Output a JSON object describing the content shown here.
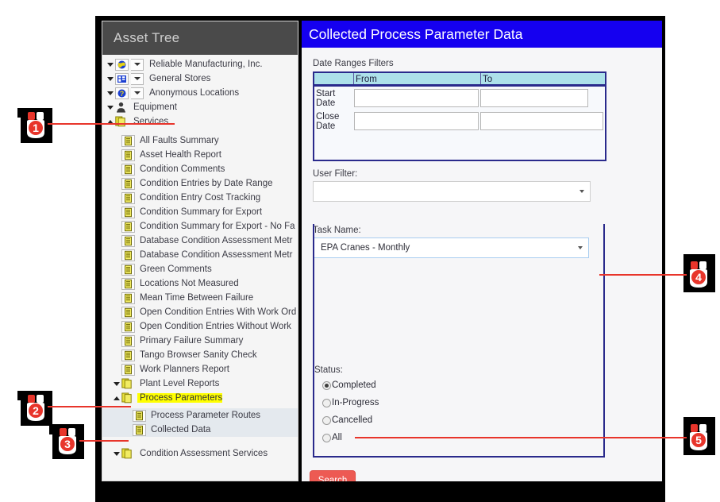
{
  "window": {
    "tree_panel_title": "Asset Tree",
    "content_title": "Collected Process Parameter Data"
  },
  "tree": {
    "items": [
      {
        "label": "Reliable Manufacturing, Inc.",
        "icon": "globe-icon",
        "level": 0,
        "caret": "down",
        "has_dropdown": true
      },
      {
        "label": "General Stores",
        "icon": "building-icon",
        "level": 0,
        "caret": "down",
        "has_dropdown": true
      },
      {
        "label": "Anonymous Locations",
        "icon": "question-globe-icon",
        "level": 0,
        "caret": "down",
        "has_dropdown": true
      },
      {
        "label": "Equipment",
        "icon": "person-icon",
        "level": 0,
        "caret": "down",
        "has_dropdown": false
      },
      {
        "label": "Services",
        "icon": "folders-icon",
        "level": 0,
        "caret": "up",
        "has_dropdown": false
      },
      {
        "label": "All Faults Summary",
        "icon": "report-icon",
        "level": 1
      },
      {
        "label": "Asset Health Report",
        "icon": "report-icon",
        "level": 1
      },
      {
        "label": "Condition Comments",
        "icon": "report-icon",
        "level": 1
      },
      {
        "label": "Condition Entries by Date Range",
        "icon": "report-icon",
        "level": 1
      },
      {
        "label": "Condition Entry Cost Tracking",
        "icon": "report-icon",
        "level": 1
      },
      {
        "label": "Condition Summary for Export",
        "icon": "report-icon",
        "level": 1
      },
      {
        "label": "Condition Summary for Export - No Fa",
        "icon": "report-icon",
        "level": 1
      },
      {
        "label": "Database Condition Assessment Metr",
        "icon": "report-icon",
        "level": 1
      },
      {
        "label": "Database Condition Assessment Metr",
        "icon": "report-icon",
        "level": 1
      },
      {
        "label": "Green Comments",
        "icon": "report-icon",
        "level": 1
      },
      {
        "label": "Locations Not Measured",
        "icon": "report-icon",
        "level": 1
      },
      {
        "label": "Mean Time Between Failure",
        "icon": "report-icon",
        "level": 1
      },
      {
        "label": "Open Condition Entries With Work Ord",
        "icon": "report-icon",
        "level": 1
      },
      {
        "label": "Open Condition Entries Without Work",
        "icon": "report-icon",
        "level": 1
      },
      {
        "label": "Primary Failure Summary",
        "icon": "report-icon",
        "level": 1
      },
      {
        "label": "Tango Browser Sanity Check",
        "icon": "report-icon",
        "level": 1
      },
      {
        "label": "Work Planners Report",
        "icon": "report-icon",
        "level": 1
      },
      {
        "label": "Plant Level Reports",
        "icon": "folders-icon",
        "level": 1,
        "caret": "down"
      },
      {
        "label": "Process Parameters",
        "icon": "folders-icon",
        "level": 1,
        "caret": "up",
        "highlighted": true
      },
      {
        "label": "Process Parameter Routes",
        "icon": "report-icon",
        "level": 2,
        "band": true
      },
      {
        "label": "Collected Data",
        "icon": "report-icon",
        "level": 2,
        "band": true
      },
      {
        "label": "Condition Assessment Services",
        "icon": "folders-icon",
        "level": 1,
        "caret": "down"
      }
    ]
  },
  "form": {
    "date_section_label": "Date Ranges Filters",
    "date_table": {
      "headers": [
        "",
        "From",
        "To"
      ],
      "rows": [
        {
          "label": "Start Date",
          "from": "",
          "to": ""
        },
        {
          "label": "Close Date",
          "from": "",
          "to": ""
        }
      ]
    },
    "user_filter": {
      "label": "User Filter:",
      "value": "",
      "placeholder": ""
    },
    "task_name": {
      "label": "Task Name:",
      "value": "EPA Cranes - Monthly"
    },
    "status": {
      "label": "Status:",
      "options": [
        {
          "label": "Completed",
          "selected": true
        },
        {
          "label": "In-Progress",
          "selected": false
        },
        {
          "label": "Cancelled",
          "selected": false
        },
        {
          "label": "All",
          "selected": false
        }
      ]
    },
    "search_button": "Search"
  },
  "callouts": [
    {
      "number": "1"
    },
    {
      "number": "2"
    },
    {
      "number": "3"
    },
    {
      "number": "4"
    },
    {
      "number": "5"
    }
  ],
  "colors": {
    "title_bar": "#1500f0",
    "tree_header": "#4a4a4a",
    "highlight": "#ffff00",
    "accent_red": "#e8352b",
    "search_button": "#ed5a53",
    "table_border": "#2a2a8c",
    "table_head": "#ade1ea"
  }
}
